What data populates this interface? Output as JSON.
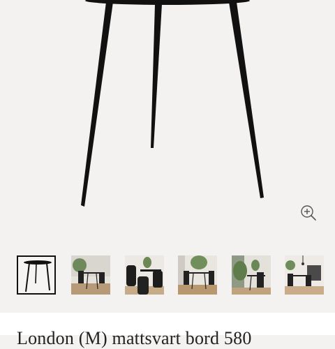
{
  "gallery": {
    "zoom_icon": "zoom-in-icon",
    "thumbnails": [
      {
        "name": "thumb-1",
        "selected": true
      },
      {
        "name": "thumb-2",
        "selected": false
      },
      {
        "name": "thumb-3",
        "selected": false
      },
      {
        "name": "thumb-4",
        "selected": false
      },
      {
        "name": "thumb-5",
        "selected": false
      },
      {
        "name": "thumb-6",
        "selected": false
      }
    ]
  },
  "product": {
    "title": "London (M) mattsvart bord 580"
  },
  "colors": {
    "background": "#f4f2f0",
    "table_black": "#111111",
    "panel": "#ffffff"
  }
}
